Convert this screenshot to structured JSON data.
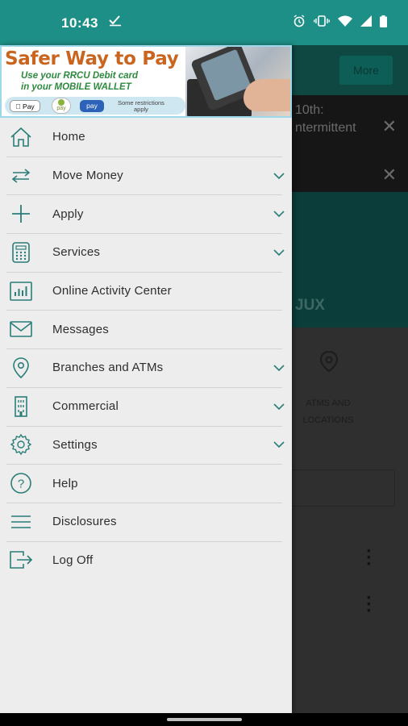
{
  "status_bar": {
    "time": "10:43",
    "icons": [
      "check-icon",
      "alarm-icon",
      "vibrate-icon",
      "wifi-icon",
      "signal-icon",
      "battery-icon"
    ]
  },
  "background_app": {
    "more_label": "More",
    "alert_text_1": "10th:",
    "alert_text_2": "ntermittent",
    "member_name_fragment": "JUX",
    "atm_label_1": "ATMS AND",
    "atm_label_2": "LOCATIONS"
  },
  "promo": {
    "title": "Safer Way to Pay",
    "line1": "Use your RRCU Debit card",
    "line2": "in your MOBILE WALLET",
    "apple_pay": " Pay",
    "google_pay": "pay",
    "samsung_pay": "pay",
    "restrictions_1": "Some restrictions",
    "restrictions_2": "apply"
  },
  "menu": {
    "items": [
      {
        "label": "Home",
        "icon": "home-icon",
        "expandable": false
      },
      {
        "label": "Move Money",
        "icon": "transfer-arrows-icon",
        "expandable": true
      },
      {
        "label": "Apply",
        "icon": "plus-icon",
        "expandable": true
      },
      {
        "label": "Services",
        "icon": "calculator-icon",
        "expandable": true
      },
      {
        "label": "Online Activity Center",
        "icon": "bar-chart-icon",
        "expandable": false
      },
      {
        "label": "Messages",
        "icon": "envelope-icon",
        "expandable": false
      },
      {
        "label": "Branches and ATMs",
        "icon": "map-pin-icon",
        "expandable": true
      },
      {
        "label": "Commercial",
        "icon": "building-icon",
        "expandable": true
      },
      {
        "label": "Settings",
        "icon": "gear-icon",
        "expandable": true
      },
      {
        "label": "Help",
        "icon": "help-circle-icon",
        "expandable": false
      },
      {
        "label": "Disclosures",
        "icon": "hamburger-lines-icon",
        "expandable": false
      },
      {
        "label": "Log Off",
        "icon": "logout-icon",
        "expandable": false
      }
    ]
  },
  "colors": {
    "accent_teal": "#1e8f86",
    "icon_teal": "#2a7d78",
    "promo_orange": "#c9651e",
    "promo_green": "#2d8a3e"
  }
}
